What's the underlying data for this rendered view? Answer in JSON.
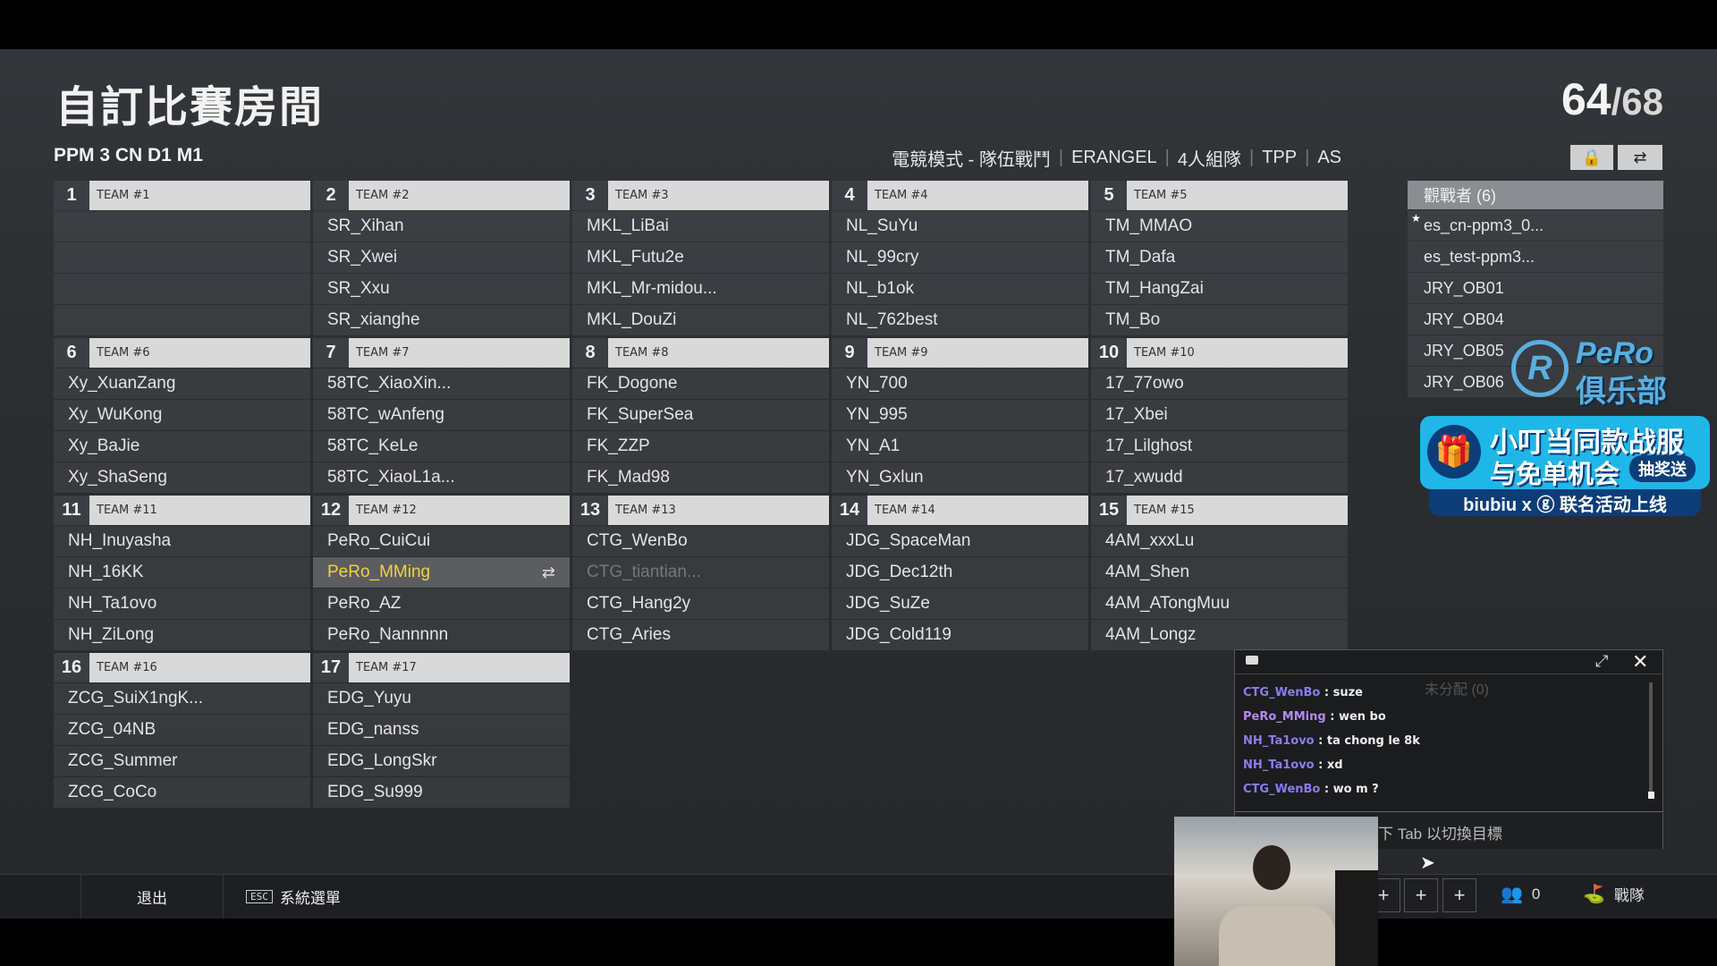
{
  "header": {
    "title": "自訂比賽房間",
    "count_current": "64",
    "count_total": "68",
    "room_name": "PPM 3 CN D1 M1",
    "settings": [
      "電競模式 - 隊伍戰鬥",
      "ERANGEL",
      "4人組隊",
      "TPP",
      "AS"
    ]
  },
  "teams": [
    {
      "num": "1",
      "label": "TEAM #1",
      "players": [
        "",
        "",
        "",
        ""
      ]
    },
    {
      "num": "2",
      "label": "TEAM #2",
      "players": [
        "SR_Xihan",
        "SR_Xwei",
        "SR_Xxu",
        "SR_xianghe"
      ]
    },
    {
      "num": "3",
      "label": "TEAM #3",
      "players": [
        "MKL_LiBai",
        "MKL_Futu2e",
        "MKL_Mr-midou...",
        "MKL_DouZi"
      ]
    },
    {
      "num": "4",
      "label": "TEAM #4",
      "players": [
        "NL_SuYu",
        "NL_99cry",
        "NL_b1ok",
        "NL_762best"
      ]
    },
    {
      "num": "5",
      "label": "TEAM #5",
      "players": [
        "TM_MMAO",
        "TM_Dafa",
        "TM_HangZai",
        "TM_Bo"
      ]
    },
    {
      "num": "6",
      "label": "TEAM #6",
      "players": [
        "Xy_XuanZang",
        "Xy_WuKong",
        "Xy_BaJie",
        "Xy_ShaSeng"
      ]
    },
    {
      "num": "7",
      "label": "TEAM #7",
      "players": [
        "58TC_XiaoXin...",
        "58TC_wAnfeng",
        "58TC_KeLe",
        "58TC_XiaoL1a..."
      ]
    },
    {
      "num": "8",
      "label": "TEAM #8",
      "players": [
        "FK_Dogone",
        "FK_SuperSea",
        "FK_ZZP",
        "FK_Mad98"
      ]
    },
    {
      "num": "9",
      "label": "TEAM #9",
      "players": [
        "YN_700",
        "YN_995",
        "YN_A1",
        "YN_Gxlun"
      ]
    },
    {
      "num": "10",
      "label": "TEAM #10",
      "players": [
        "17_77owo",
        "17_Xbei",
        "17_Lilghost",
        "17_xwudd"
      ]
    },
    {
      "num": "11",
      "label": "TEAM #11",
      "players": [
        "NH_Inuyasha",
        "NH_16KK",
        "NH_Ta1ovo",
        "NH_ZiLong"
      ]
    },
    {
      "num": "12",
      "label": "TEAM #12",
      "players": [
        "PeRo_CuiCui",
        "PeRo_MMing",
        "PeRo_AZ",
        "PeRo_Nannnnn"
      ]
    },
    {
      "num": "13",
      "label": "TEAM #13",
      "players": [
        "CTG_WenBo",
        "CTG_tiantian...",
        "CTG_Hang2y",
        "CTG_Aries"
      ]
    },
    {
      "num": "14",
      "label": "TEAM #14",
      "players": [
        "JDG_SpaceMan",
        "JDG_Dec12th",
        "JDG_SuZe",
        "JDG_Cold119"
      ]
    },
    {
      "num": "15",
      "label": "TEAM #15",
      "players": [
        "4AM_xxxLu",
        "4AM_Shen",
        "4AM_ATongMuu",
        "4AM_Longz"
      ]
    },
    {
      "num": "16",
      "label": "TEAM #16",
      "players": [
        "ZCG_SuiX1ngK...",
        "ZCG_04NB",
        "ZCG_Summer",
        "ZCG_CoCo"
      ]
    },
    {
      "num": "17",
      "label": "TEAM #17",
      "players": [
        "EDG_Yuyu",
        "EDG_nanss",
        "EDG_LongSkr",
        "EDG_Su999"
      ]
    }
  ],
  "spectators": {
    "header": "觀戰者 (6)",
    "list": [
      "es_cn-ppm3_0...",
      "es_test-ppm3...",
      "JRY_OB01",
      "JRY_OB04",
      "JRY_OB05",
      "JRY_OB06"
    ]
  },
  "overlay": {
    "brand_en": "PeRo",
    "brand_cn": "俱乐部",
    "ad_line1": "小叮当同款战服",
    "ad_line2": "与免单机会",
    "ad_badge": "抽奖送",
    "ad_bottom": "biubiu x ⓖ 联名活动上线"
  },
  "chat": {
    "messages": [
      {
        "name": "CTG_WenBo",
        "text": " : suze"
      },
      {
        "name": "PeRo_MMing",
        "text": " : wen bo"
      },
      {
        "name": "NH_Ta1ovo",
        "text": " : ta chong le 8k"
      },
      {
        "name": "NH_Ta1ovo",
        "text": " : xd"
      },
      {
        "name": "CTG_WenBo",
        "text": " : wo m ?"
      }
    ],
    "hint": "下 Tab 以切換目標",
    "ghost": "未分配 (0)"
  },
  "bottom": {
    "exit": "退出",
    "esc_key": "ESC",
    "system_menu": "系統選單",
    "friends_count": "0",
    "squad": "戰隊"
  },
  "colors": {
    "highlight_player": "#f0d33c",
    "chat_name": "#8b7cf0",
    "team_header": "#d9d9d9"
  }
}
